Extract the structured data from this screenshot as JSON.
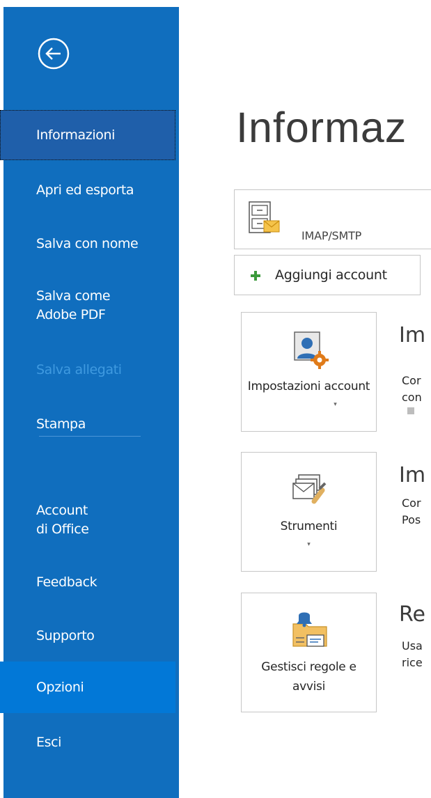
{
  "sidebar": {
    "items": [
      {
        "label": "Informazioni",
        "state": "selected"
      },
      {
        "label": "Apri ed esporta",
        "state": "normal"
      },
      {
        "label": "Salva con nome",
        "state": "normal"
      },
      {
        "label": "Salva come\nAdobe PDF",
        "state": "normal"
      },
      {
        "label": "Salva allegati",
        "state": "disabled"
      },
      {
        "label": "Stampa",
        "state": "normal"
      },
      {
        "label": "Account\ndi Office",
        "state": "normal"
      },
      {
        "label": "Feedback",
        "state": "normal"
      },
      {
        "label": "Supporto",
        "state": "normal"
      },
      {
        "label": "Opzioni",
        "state": "highlight"
      },
      {
        "label": "Esci",
        "state": "normal"
      }
    ]
  },
  "main": {
    "title": "Informaz",
    "account": {
      "type": "IMAP/SMTP"
    },
    "add_account_label": "Aggiungi account",
    "tiles": [
      {
        "label": "Impostazioni account",
        "section_title": "Im",
        "desc1": "Cor",
        "desc2": "con"
      },
      {
        "label": "Strumenti",
        "section_title": "Im",
        "desc1": "Cor",
        "desc2": "Pos"
      },
      {
        "label": "Gestisci regole e avvisi",
        "section_title": "Re",
        "desc1": "Usa",
        "desc2": "rice"
      }
    ]
  },
  "colors": {
    "sidebar_bg": "#106ebe",
    "selected_bg": "#1f5faa",
    "highlight_bg": "#0278d7",
    "disabled_text": "#3f9ae0",
    "add_icon": "#3c9a3c"
  },
  "icons": [
    "back-arrow-icon",
    "mail-cabinet-icon",
    "plus-icon",
    "account-settings-icon",
    "tools-icon",
    "rules-alerts-icon"
  ]
}
